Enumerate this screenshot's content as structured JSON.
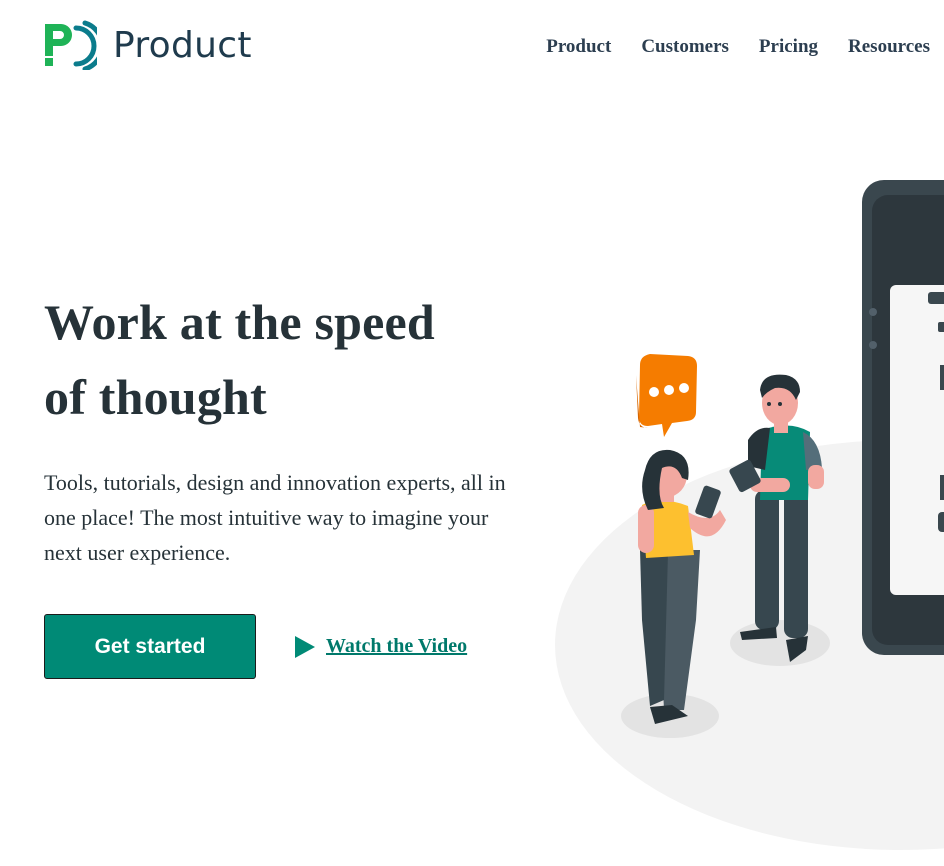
{
  "brand": {
    "name": "Product",
    "icon": "brand-logo-icon",
    "colors": {
      "green": "#1fb357",
      "teal": "#0b7c8c",
      "navy": "#1f3b4d"
    }
  },
  "nav": {
    "items": [
      "Product",
      "Customers",
      "Pricing",
      "Resources"
    ]
  },
  "hero": {
    "title_line1": "Work at the speed",
    "title_line2": "of thought",
    "description": "Tools, tutorials, design and innovation experts, all in one place! The most intuitive way to imagine your next user experience."
  },
  "actions": {
    "primary_label": "Get started",
    "video_label": "Watch the Video",
    "video_icon": "play-icon"
  },
  "theme": {
    "accent": "#008a76",
    "text": "#263238"
  }
}
